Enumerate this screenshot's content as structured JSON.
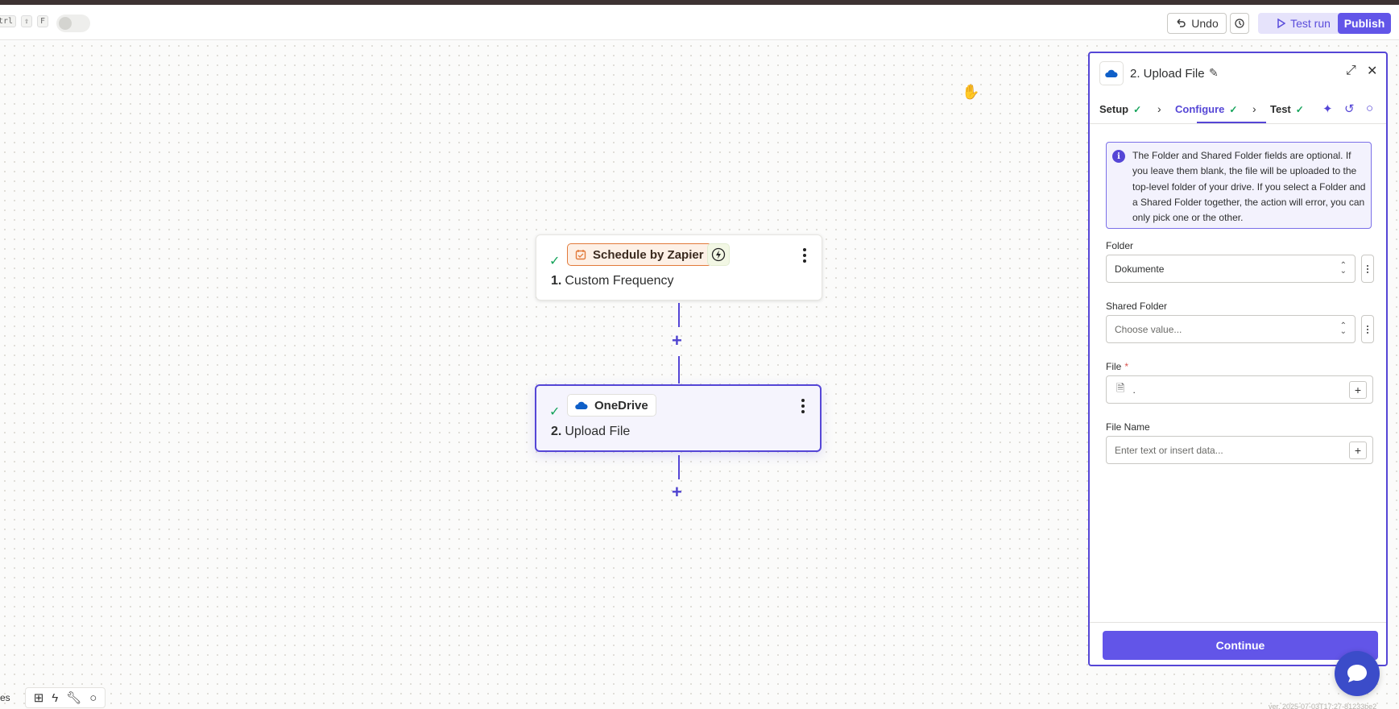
{
  "topbar": {
    "kbd_keys": [
      "trl",
      "⇧",
      "F"
    ],
    "undo_label": "Undo",
    "test_run_label": "Test run",
    "publish_label": "Publish"
  },
  "canvas": {
    "nodes": [
      {
        "number": "1.",
        "title": "Custom Frequency",
        "app": "Schedule by Zapier",
        "status": "check"
      },
      {
        "number": "2.",
        "title": "Upload File",
        "app": "OneDrive",
        "status": "check"
      }
    ]
  },
  "bottombar": {
    "label": "es"
  },
  "version_text": "ver. 2025-07-03T17:27-81233be2",
  "panel": {
    "title": "2. Upload File",
    "tabs": [
      {
        "label": "Setup",
        "done": true
      },
      {
        "label": "Configure",
        "done": true,
        "active": true
      },
      {
        "label": "Test",
        "done": true
      }
    ],
    "info_text": "The Folder and Shared Folder fields are optional. If you leave them blank, the file will be uploaded to the top-level folder of your drive. If you select a Folder and a Shared Folder together, the action will error, you can only pick one or the other.",
    "fields": {
      "folder": {
        "label": "Folder",
        "value": "Dokumente"
      },
      "shared_folder": {
        "label": "Shared Folder",
        "placeholder": "Choose value..."
      },
      "file": {
        "label": "File",
        "required_mark": "*",
        "value": "."
      },
      "file_name": {
        "label": "File Name",
        "placeholder": "Enter text or insert data..."
      }
    },
    "continue_label": "Continue"
  },
  "colors": {
    "accent": "#5546d6",
    "publish": "#6255e8",
    "success": "#14a35a",
    "trigger_orange": "#e27a3a",
    "onedrive_blue": "#0f5fc8"
  }
}
